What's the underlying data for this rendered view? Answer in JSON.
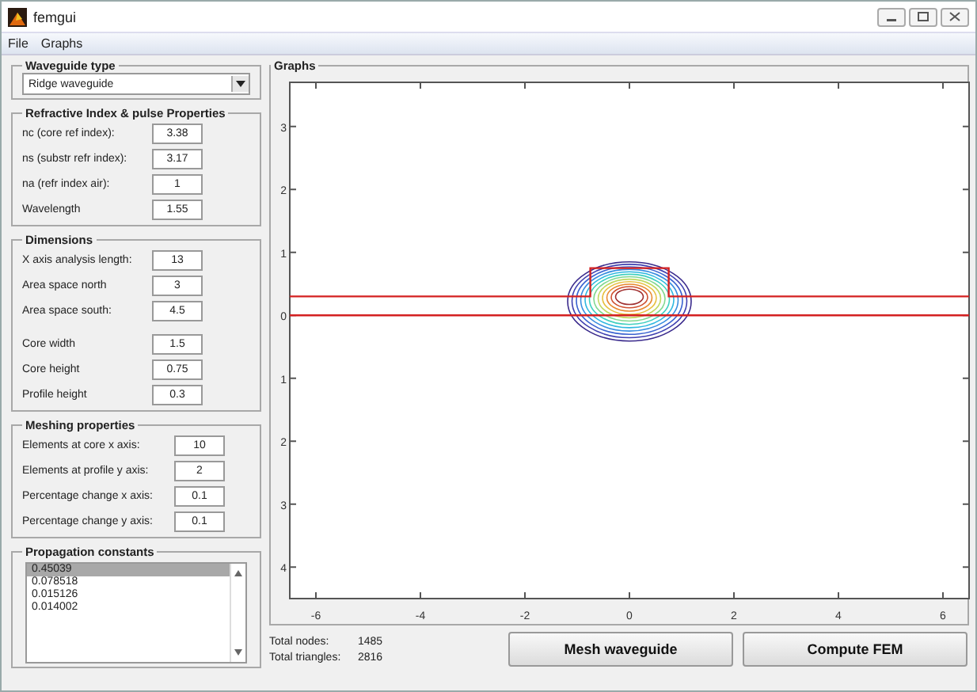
{
  "window": {
    "title": "femgui"
  },
  "menu": [
    "File",
    "Graphs"
  ],
  "waveguide_type": {
    "title": "Waveguide type",
    "value": "Ridge waveguide"
  },
  "refractive": {
    "title": "Refractive Index & pulse Properties",
    "fields": [
      {
        "label": "nc (core ref index):",
        "value": "3.38"
      },
      {
        "label": "ns (substr refr index):",
        "value": "3.17"
      },
      {
        "label": "na (refr index air):",
        "value": "1"
      },
      {
        "label": "Wavelength",
        "value": "1.55"
      }
    ]
  },
  "dimensions": {
    "title": "Dimensions",
    "fields": [
      {
        "label": "X axis analysis length:",
        "value": "13"
      },
      {
        "label": "Area space north",
        "value": "3"
      },
      {
        "label": "Area space south:",
        "value": "4.5"
      },
      {
        "label": "Core width",
        "value": "1.5"
      },
      {
        "label": "Core height",
        "value": "0.75"
      },
      {
        "label": "Profile height",
        "value": "0.3"
      }
    ]
  },
  "meshing": {
    "title": "Meshing properties",
    "fields": [
      {
        "label": "Elements at core x axis:",
        "value": "10"
      },
      {
        "label": "Elements at profile y axis:",
        "value": "2"
      },
      {
        "label": "Percentage change x axis:",
        "value": "0.1"
      },
      {
        "label": "Percentage change y axis:",
        "value": "0.1"
      }
    ]
  },
  "propagation": {
    "title": "Propagation constants",
    "items": [
      {
        "label": "0.45039",
        "selected": true
      },
      {
        "label": "0.078518",
        "selected": false
      },
      {
        "label": "0.015126",
        "selected": false
      },
      {
        "label": "0.014002",
        "selected": false
      }
    ]
  },
  "graphs": {
    "title": "Graphs",
    "chart_data": {
      "type": "line",
      "xlim": [
        -6.5,
        6.5
      ],
      "ylim": [
        -4.5,
        3.7
      ],
      "xticks": [
        -6,
        -4,
        -2,
        0,
        2,
        4,
        6
      ],
      "yticks": [
        {
          "value": 3,
          "label": "3"
        },
        {
          "value": 2,
          "label": "2"
        },
        {
          "value": 1,
          "label": "1"
        },
        {
          "value": 0,
          "label": "0"
        },
        {
          "value": -1,
          "label": "1"
        },
        {
          "value": -2,
          "label": "2"
        },
        {
          "value": -3,
          "label": "3"
        },
        {
          "value": -4,
          "label": "4"
        }
      ],
      "x": [
        -6.5,
        -0.75,
        -0.75,
        0.75,
        0.75,
        6.5
      ],
      "series": [
        {
          "color": "#d42020",
          "values": [
            0.3,
            0.3,
            0.75,
            0.75,
            0.3,
            0.3
          ]
        },
        {
          "color": "#d42021",
          "values": [
            0,
            0,
            0,
            0,
            0,
            0
          ]
        }
      ]
    }
  },
  "stats": [
    {
      "label": "Total nodes:",
      "value": "1485"
    },
    {
      "label": "Total triangles:",
      "value": "2816"
    }
  ],
  "buttons": [
    "Mesh waveguide",
    "Compute FEM"
  ]
}
